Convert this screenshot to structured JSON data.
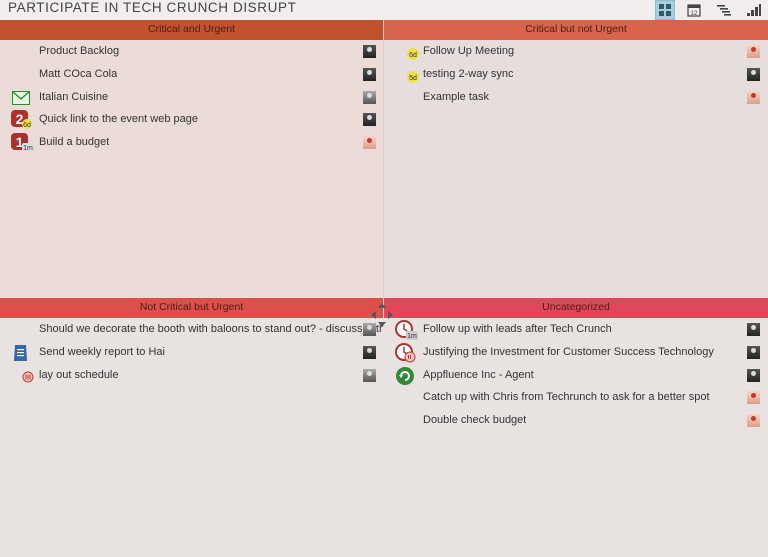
{
  "header": {
    "title": "PARTICIPATE IN TECH CRUNCH DISRUPT",
    "toolbar": [
      "grid-view-icon",
      "calendar-view-icon",
      "gantt-view-icon",
      "bar-chart-icon"
    ],
    "calendar_day": "12"
  },
  "quadrants": [
    {
      "title": "Critical and Urgent",
      "color": "#c0522e",
      "items": [
        {
          "label": "Product Backlog",
          "icon": "",
          "badge": "",
          "avatar": "dark"
        },
        {
          "label": "Matt COca Cola",
          "icon": "",
          "badge": "",
          "avatar": "dark"
        },
        {
          "label": "Italian Cuisine",
          "icon": "envelope-icon",
          "badge": "",
          "avatar": "gray"
        },
        {
          "label": "Quick link to the event web page",
          "icon": "priority-2-icon",
          "badge": "2",
          "sub": "6d",
          "avatar": "dark"
        },
        {
          "label": "Build a budget",
          "icon": "priority-1-icon",
          "badge": "1",
          "sub": "1m",
          "avatar": "red"
        }
      ]
    },
    {
      "title": "Critical but not Urgent",
      "color": "#d9644e",
      "items": [
        {
          "label": "Follow Up Meeting",
          "icon": "due-badge-icon",
          "sub": "6d",
          "avatar": "red"
        },
        {
          "label": "testing 2-way sync",
          "icon": "due-badge-icon",
          "sub": "5d",
          "avatar": "dark"
        },
        {
          "label": "Example task",
          "icon": "",
          "sub": "",
          "avatar": "red"
        }
      ]
    },
    {
      "title": "Not Critical but Urgent",
      "color": "#dd4f4a",
      "items": [
        {
          "label": "Should we decorate the booth with baloons to stand out? - discuss with the a",
          "icon": "",
          "avatar": "gray"
        },
        {
          "label": "Send weekly report to Hai",
          "icon": "document-icon",
          "avatar": "dark"
        },
        {
          "label": "lay out schedule",
          "icon": "overdue-icon",
          "avatar": "gray"
        }
      ]
    },
    {
      "title": "Uncategorized",
      "color": "#e0475a",
      "items": [
        {
          "label": "Follow up with leads after Tech Crunch",
          "icon": "clock-icon",
          "sub": "1m",
          "avatar": "dark"
        },
        {
          "label": "Justifying the Investment for Customer Success Technology",
          "icon": "clock-overdue-icon",
          "sub": "",
          "avatar": "dark"
        },
        {
          "label": "Appfluence Inc - Agent",
          "icon": "recurring-icon",
          "sub": "",
          "avatar": "dark"
        },
        {
          "label": "Catch up with Chris from Techrunch to ask for a better spot",
          "icon": "",
          "sub": "",
          "avatar": "red"
        },
        {
          "label": "Double check budget",
          "icon": "",
          "sub": "",
          "avatar": "red"
        }
      ]
    }
  ]
}
